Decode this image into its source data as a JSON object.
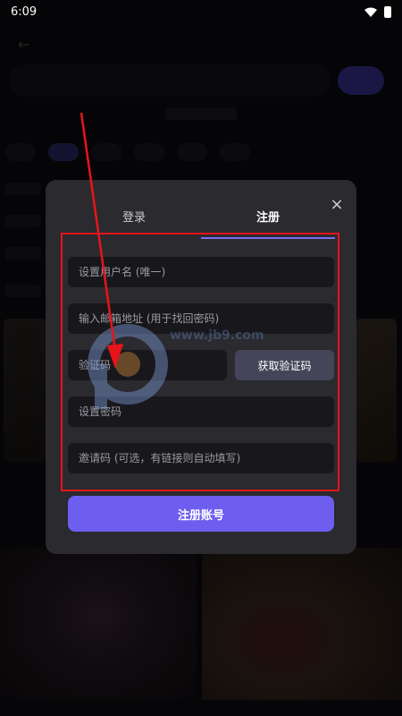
{
  "status_bar": {
    "time": "6:09"
  },
  "modal": {
    "tabs": [
      {
        "label": "登录"
      },
      {
        "label": "注册"
      }
    ],
    "fields": {
      "username_placeholder": "设置用户名 (唯一)",
      "email_placeholder": "输入邮箱地址 (用于找回密码)",
      "code_placeholder": "验证码",
      "password_placeholder": "设置密码",
      "invite_placeholder": "邀请码 (可选，有链接则自动填写)"
    },
    "get_code_label": "获取验证码",
    "submit_label": "注册账号"
  },
  "watermark": {
    "text": "www.jb9.com"
  },
  "colors": {
    "accent": "#6e5ef0",
    "annotation": "#e8141b"
  }
}
